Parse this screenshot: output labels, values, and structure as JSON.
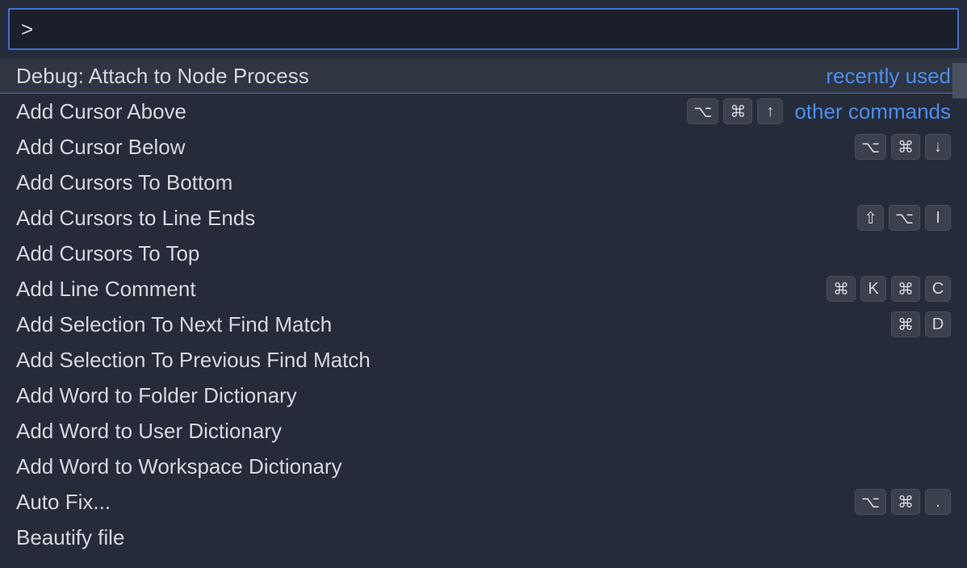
{
  "input": {
    "value": ">",
    "placeholder": ""
  },
  "groups": {
    "recent": "recently used",
    "other": "other commands"
  },
  "keys": {
    "option": "⌥",
    "command": "⌘",
    "shift": "⇧",
    "up": "↑",
    "down": "↓",
    "letter_i": "I",
    "letter_k": "K",
    "letter_c": "C",
    "letter_d": "D",
    "dot": "."
  },
  "items": [
    {
      "label": "Debug: Attach to Node Process",
      "selected": true,
      "group": "recent",
      "keybinding": null
    },
    {
      "label": "Add Cursor Above",
      "selected": false,
      "group": "other",
      "keybinding": [
        [
          "option",
          "command",
          "up"
        ]
      ]
    },
    {
      "label": "Add Cursor Below",
      "selected": false,
      "group": null,
      "keybinding": [
        [
          "option",
          "command",
          "down"
        ]
      ]
    },
    {
      "label": "Add Cursors To Bottom",
      "selected": false,
      "group": null,
      "keybinding": null
    },
    {
      "label": "Add Cursors to Line Ends",
      "selected": false,
      "group": null,
      "keybinding": [
        [
          "shift",
          "option",
          "letter_i"
        ]
      ]
    },
    {
      "label": "Add Cursors To Top",
      "selected": false,
      "group": null,
      "keybinding": null
    },
    {
      "label": "Add Line Comment",
      "selected": false,
      "group": null,
      "keybinding": [
        [
          "command",
          "letter_k"
        ],
        [
          "command",
          "letter_c"
        ]
      ]
    },
    {
      "label": "Add Selection To Next Find Match",
      "selected": false,
      "group": null,
      "keybinding": [
        [
          "command",
          "letter_d"
        ]
      ]
    },
    {
      "label": "Add Selection To Previous Find Match",
      "selected": false,
      "group": null,
      "keybinding": null
    },
    {
      "label": "Add Word to Folder Dictionary",
      "selected": false,
      "group": null,
      "keybinding": null
    },
    {
      "label": "Add Word to User Dictionary",
      "selected": false,
      "group": null,
      "keybinding": null
    },
    {
      "label": "Add Word to Workspace Dictionary",
      "selected": false,
      "group": null,
      "keybinding": null
    },
    {
      "label": "Auto Fix...",
      "selected": false,
      "group": null,
      "keybinding": [
        [
          "option",
          "command",
          "dot"
        ]
      ]
    },
    {
      "label": "Beautify file",
      "selected": false,
      "group": null,
      "keybinding": null
    }
  ]
}
